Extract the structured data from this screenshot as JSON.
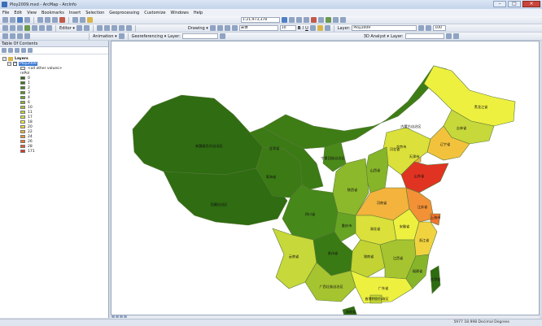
{
  "window": {
    "title": "Ploy2009.mxd - ArcMap - ArcInfo",
    "controls": [
      "–",
      "□",
      "×"
    ]
  },
  "menu": [
    "File",
    "Edit",
    "View",
    "Bookmarks",
    "Insert",
    "Selection",
    "Geoprocessing",
    "Customize",
    "Windows",
    "Help"
  ],
  "toolbar": {
    "scale": "1:21,973,378",
    "editor_label": "Editor ▾",
    "drawing_label": "Drawing ▾",
    "font_name": "宋体",
    "font_size": "10",
    "bold": "B",
    "italic": "I",
    "underline": "U",
    "layer_label": "Layer:",
    "layer_value": "Ploy2009",
    "zoom_value": "100",
    "animation_label": "Animation ▾",
    "georeferencing_label": "Georeferencing ▾",
    "layer2_label": "Layer:",
    "analyst_label": "3D Analyst ▾",
    "3d_layer_label": "Layer:"
  },
  "toc": {
    "title": "Table Of Contents",
    "root": "Layers",
    "layer_name": "Ploy2009",
    "other_values": "<all other values>",
    "field": "rePol",
    "legend": [
      {
        "label": "0",
        "color": "#2e6b12"
      },
      {
        "label": "1",
        "color": "#3a7a14"
      },
      {
        "label": "2",
        "color": "#46881a"
      },
      {
        "label": "3",
        "color": "#56961e"
      },
      {
        "label": "4",
        "color": "#67a423"
      },
      {
        "label": "6",
        "color": "#86b52a"
      },
      {
        "label": "10",
        "color": "#a6c42f"
      },
      {
        "label": "11",
        "color": "#c2d333"
      },
      {
        "label": "17",
        "color": "#dbe03a"
      },
      {
        "label": "18",
        "color": "#eef040"
      },
      {
        "label": "20",
        "color": "#f1d340"
      },
      {
        "label": "22",
        "color": "#f3b33c"
      },
      {
        "label": "24",
        "color": "#f29136"
      },
      {
        "label": "26",
        "color": "#ef7430"
      },
      {
        "label": "28",
        "color": "#ea5529"
      },
      {
        "label": "171",
        "color": "#e03322"
      }
    ]
  },
  "map": {
    "provinces": [
      {
        "name": "新疆维吾尔自治区",
        "color": "#2f6c12"
      },
      {
        "name": "西藏自治区",
        "color": "#2f6c12"
      },
      {
        "name": "青海省",
        "color": "#3b7a15"
      },
      {
        "name": "甘肃省",
        "color": "#3b7a15"
      },
      {
        "name": "内蒙古自治区",
        "color": "#3e7d16"
      },
      {
        "name": "黑龙江省",
        "color": "#eef040"
      },
      {
        "name": "吉林省",
        "color": "#c7d83a"
      },
      {
        "name": "辽宁省",
        "color": "#f3c23c"
      },
      {
        "name": "北京市",
        "color": "#f29136"
      },
      {
        "name": "天津市",
        "color": "#f3b33c"
      },
      {
        "name": "河北省",
        "color": "#dbe03a"
      },
      {
        "name": "山西省",
        "color": "#86b52a"
      },
      {
        "name": "宁夏回族自治区",
        "color": "#4a8a1a"
      },
      {
        "name": "陕西省",
        "color": "#8cb82b"
      },
      {
        "name": "山东省",
        "color": "#e03322"
      },
      {
        "name": "河南省",
        "color": "#f3b33c"
      },
      {
        "name": "江苏省",
        "color": "#f29136"
      },
      {
        "name": "安徽省",
        "color": "#eef040"
      },
      {
        "name": "上海市",
        "color": "#ef7430"
      },
      {
        "name": "四川省",
        "color": "#46881a"
      },
      {
        "name": "重庆市",
        "color": "#67a423"
      },
      {
        "name": "湖北省",
        "color": "#dbe03a"
      },
      {
        "name": "浙江省",
        "color": "#f1d340"
      },
      {
        "name": "湖南省",
        "color": "#c2d333"
      },
      {
        "name": "江西省",
        "color": "#a6c42f"
      },
      {
        "name": "云南省",
        "color": "#c7d83a"
      },
      {
        "name": "贵州省",
        "color": "#3a7a14"
      },
      {
        "name": "福建省",
        "color": "#86b52a"
      },
      {
        "name": "广西壮族自治区",
        "color": "#a6c42f"
      },
      {
        "name": "广东省",
        "color": "#eef040"
      },
      {
        "name": "台湾省",
        "color": "#2e6b12"
      },
      {
        "name": "海南省",
        "color": "#2e6b12"
      },
      {
        "name": "香港特别行政区",
        "color": "#c2d333"
      }
    ]
  },
  "status": {
    "coordinates": "5977 18.998 Decimal Degrees"
  }
}
